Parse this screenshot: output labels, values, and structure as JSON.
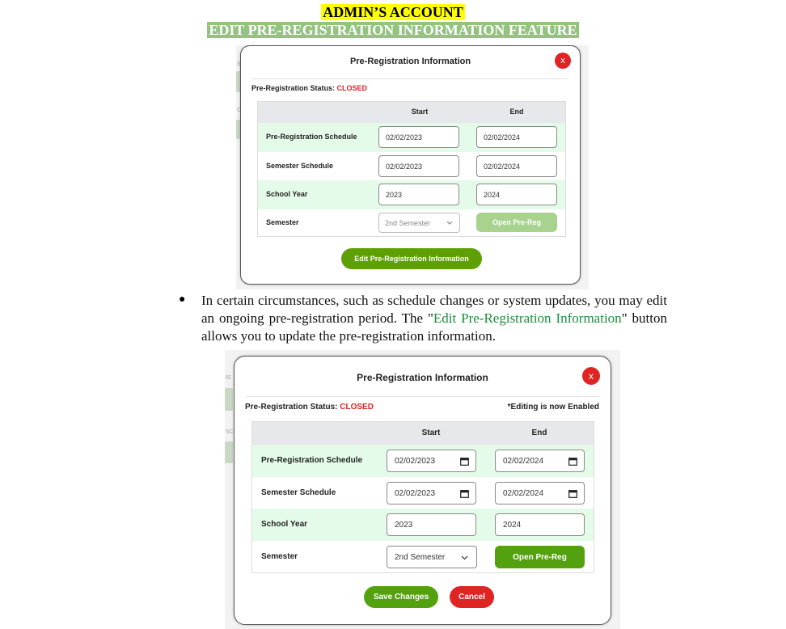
{
  "document": {
    "title": "ADMIN’S ACCOUNT",
    "subtitle": "EDIT PRE-REGISTRATION INFORMATION FEATURE",
    "paragraph": {
      "bullet": "●",
      "before": "In certain circumstances, such as schedule changes or system updates, you may edit an ongoing pre-registration period. The \"",
      "highlight": "Edit Pre-Registration Information",
      "after": "\" button allows you to update the pre-registration information."
    },
    "colors": {
      "title_bg": "#ffff00",
      "subtitle_bg": "#93c47d",
      "highlight": "#1e8b3c"
    }
  },
  "modal_view": {
    "title": "Pre-Registration Information",
    "close_label": "x",
    "status_label": "Pre-Registration Status:",
    "status_value": "CLOSED",
    "headers": {
      "start": "Start",
      "end": "End"
    },
    "rows": [
      {
        "label": "Pre-Registration Schedule",
        "start": "02/02/2023",
        "end": "02/02/2024"
      },
      {
        "label": "Semester Schedule",
        "start": "02/02/2023",
        "end": "02/02/2024"
      },
      {
        "label": "School Year",
        "start": "2023",
        "end": "2024"
      }
    ],
    "semester": {
      "label": "Semester",
      "selected": "2nd Semester",
      "open_button": "Open Pre-Reg"
    },
    "edit_button": "Edit Pre-Registration Information",
    "colors": {
      "closed": "#e02424",
      "green_row": "#e5fbe9",
      "open_disabled": "#a8d38f",
      "edit_button": "#5ea004"
    }
  },
  "modal_edit": {
    "title": "Pre-Registration Information",
    "close_label": "x",
    "status_label": "Pre-Registration Status:",
    "status_value": "CLOSED",
    "editing_note": "*Editing is now Enabled",
    "headers": {
      "start": "Start",
      "end": "End"
    },
    "rows": [
      {
        "label": "Pre-Registration Schedule",
        "start": "02/02/2023",
        "end": "02/02/2024"
      },
      {
        "label": "Semester Schedule",
        "start": "02/02/2023",
        "end": "02/02/2024"
      },
      {
        "label": "School Year",
        "start": "2023",
        "end": "2024"
      }
    ],
    "semester": {
      "label": "Semester",
      "selected": "2nd Semester",
      "open_button": "Open Pre-Reg"
    },
    "save_button": "Save Changes",
    "cancel_button": "Cancel",
    "icons": {
      "calendar": "calendar-icon",
      "dropdown": "chevron-down-icon"
    },
    "colors": {
      "open_enabled": "#54a10f",
      "save": "#54a10f",
      "cancel": "#e02424"
    }
  }
}
